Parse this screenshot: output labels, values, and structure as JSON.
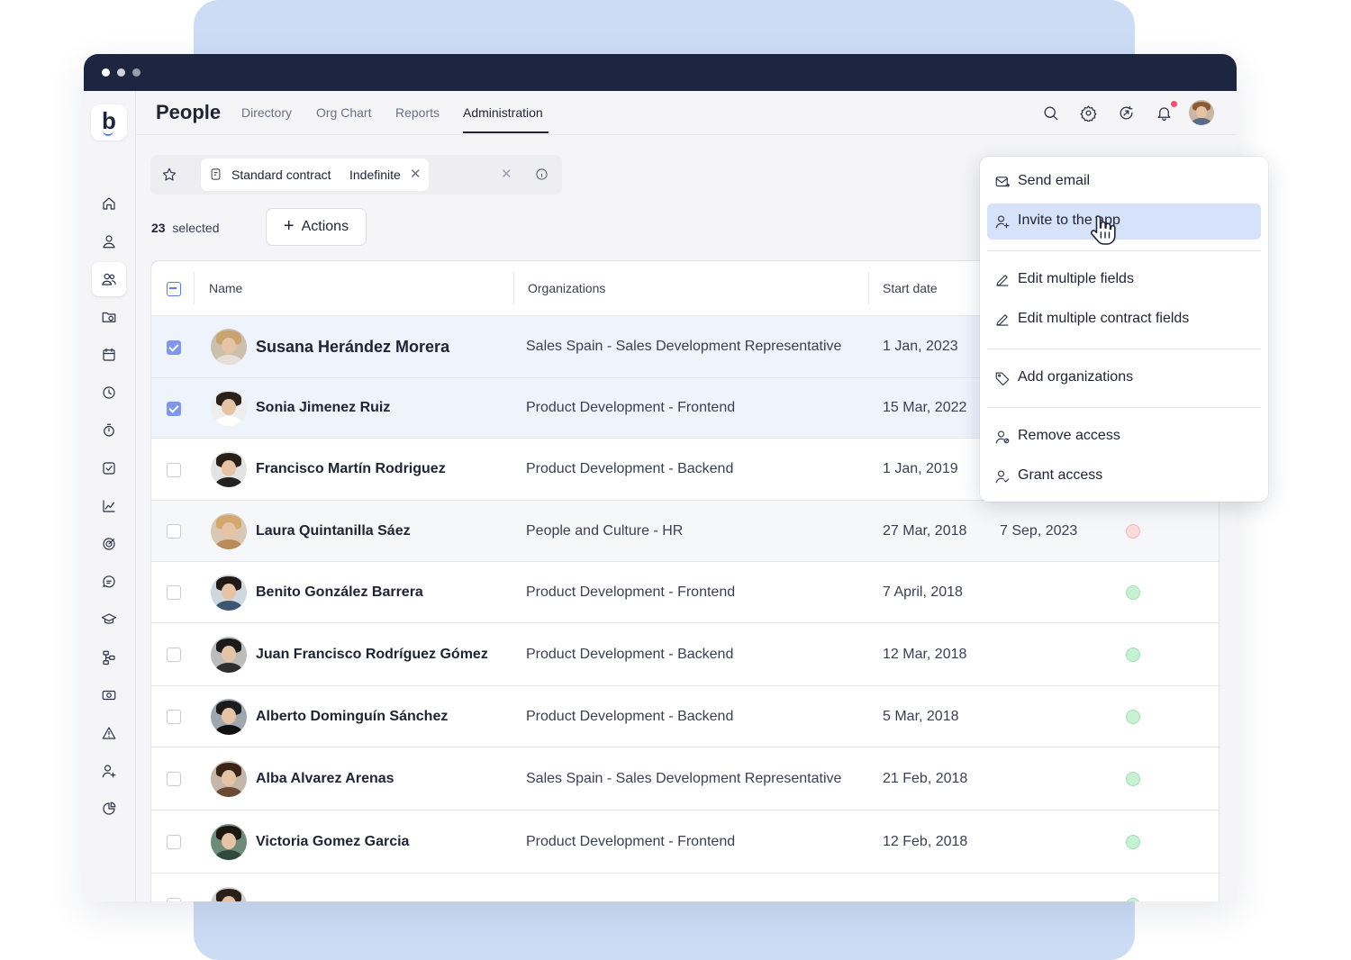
{
  "app": {
    "title": "People"
  },
  "tabs": [
    {
      "label": "Directory"
    },
    {
      "label": "Org Chart"
    },
    {
      "label": "Reports"
    },
    {
      "label": "Administration"
    }
  ],
  "filter": {
    "label": "Standard contract",
    "value": "Indefinite"
  },
  "selection": {
    "count": "23",
    "label": "selected"
  },
  "actions": {
    "label": "Actions"
  },
  "table": {
    "columns": [
      "Name",
      "Organizations",
      "Start date"
    ],
    "rows": [
      {
        "name": "Susana Herández Morera",
        "org": "Sales Spain - Sales Development Representative",
        "start": "1 Jan, 2023",
        "end": "",
        "status": "",
        "checked": true
      },
      {
        "name": "Sonia Jimenez Ruiz",
        "org": "Product Development - Frontend",
        "start": "15 Mar, 2022",
        "end": "",
        "status": "",
        "checked": true
      },
      {
        "name": "Francisco Martín Rodriguez",
        "org": "Product Development - Backend",
        "start": "1 Jan, 2019",
        "end": "",
        "status": "",
        "checked": false
      },
      {
        "name": "Laura Quintanilla Sáez",
        "org": "People and Culture - HR",
        "start": "27 Mar, 2018",
        "end": "7 Sep, 2023",
        "status": "red",
        "checked": false
      },
      {
        "name": "Benito González Barrera",
        "org": "Product Development - Frontend",
        "start": "7 April, 2018",
        "end": "",
        "status": "green",
        "checked": false
      },
      {
        "name": "Juan Francisco Rodríguez Gómez",
        "org": "Product Development - Backend",
        "start": "12 Mar, 2018",
        "end": "",
        "status": "green",
        "checked": false
      },
      {
        "name": "Alberto Dominguín Sánchez",
        "org": "Product Development - Backend",
        "start": "5 Mar, 2018",
        "end": "",
        "status": "green",
        "checked": false
      },
      {
        "name": "Alba Alvarez Arenas",
        "org": "Sales Spain - Sales Development Representative",
        "start": "21 Feb, 2018",
        "end": "",
        "status": "green",
        "checked": false
      },
      {
        "name": "Victoria Gomez Garcia",
        "org": "Product Development - Frontend",
        "start": "12 Feb, 2018",
        "end": "",
        "status": "green",
        "checked": false
      }
    ]
  },
  "menu": {
    "items": [
      {
        "label": "Send email",
        "icon": "mail-send-icon"
      },
      {
        "label": "Invite to the app",
        "icon": "user-invite-icon"
      },
      {
        "label": "Edit multiple fields",
        "icon": "pencil-icon"
      },
      {
        "label": "Edit multiple contract fields",
        "icon": "pencil-icon"
      },
      {
        "label": "Add organizations",
        "icon": "tag-icon"
      },
      {
        "label": "Remove access",
        "icon": "user-remove-icon"
      },
      {
        "label": "Grant access",
        "icon": "user-grant-icon"
      }
    ]
  },
  "colors": {
    "accent": "#5b7be8",
    "nav_dark": "#1d2640",
    "selected_row": "#eef3fc",
    "menu_highlight": "#d6e2fa",
    "status_green": "#c8f0d3",
    "status_red": "#fbdada"
  }
}
